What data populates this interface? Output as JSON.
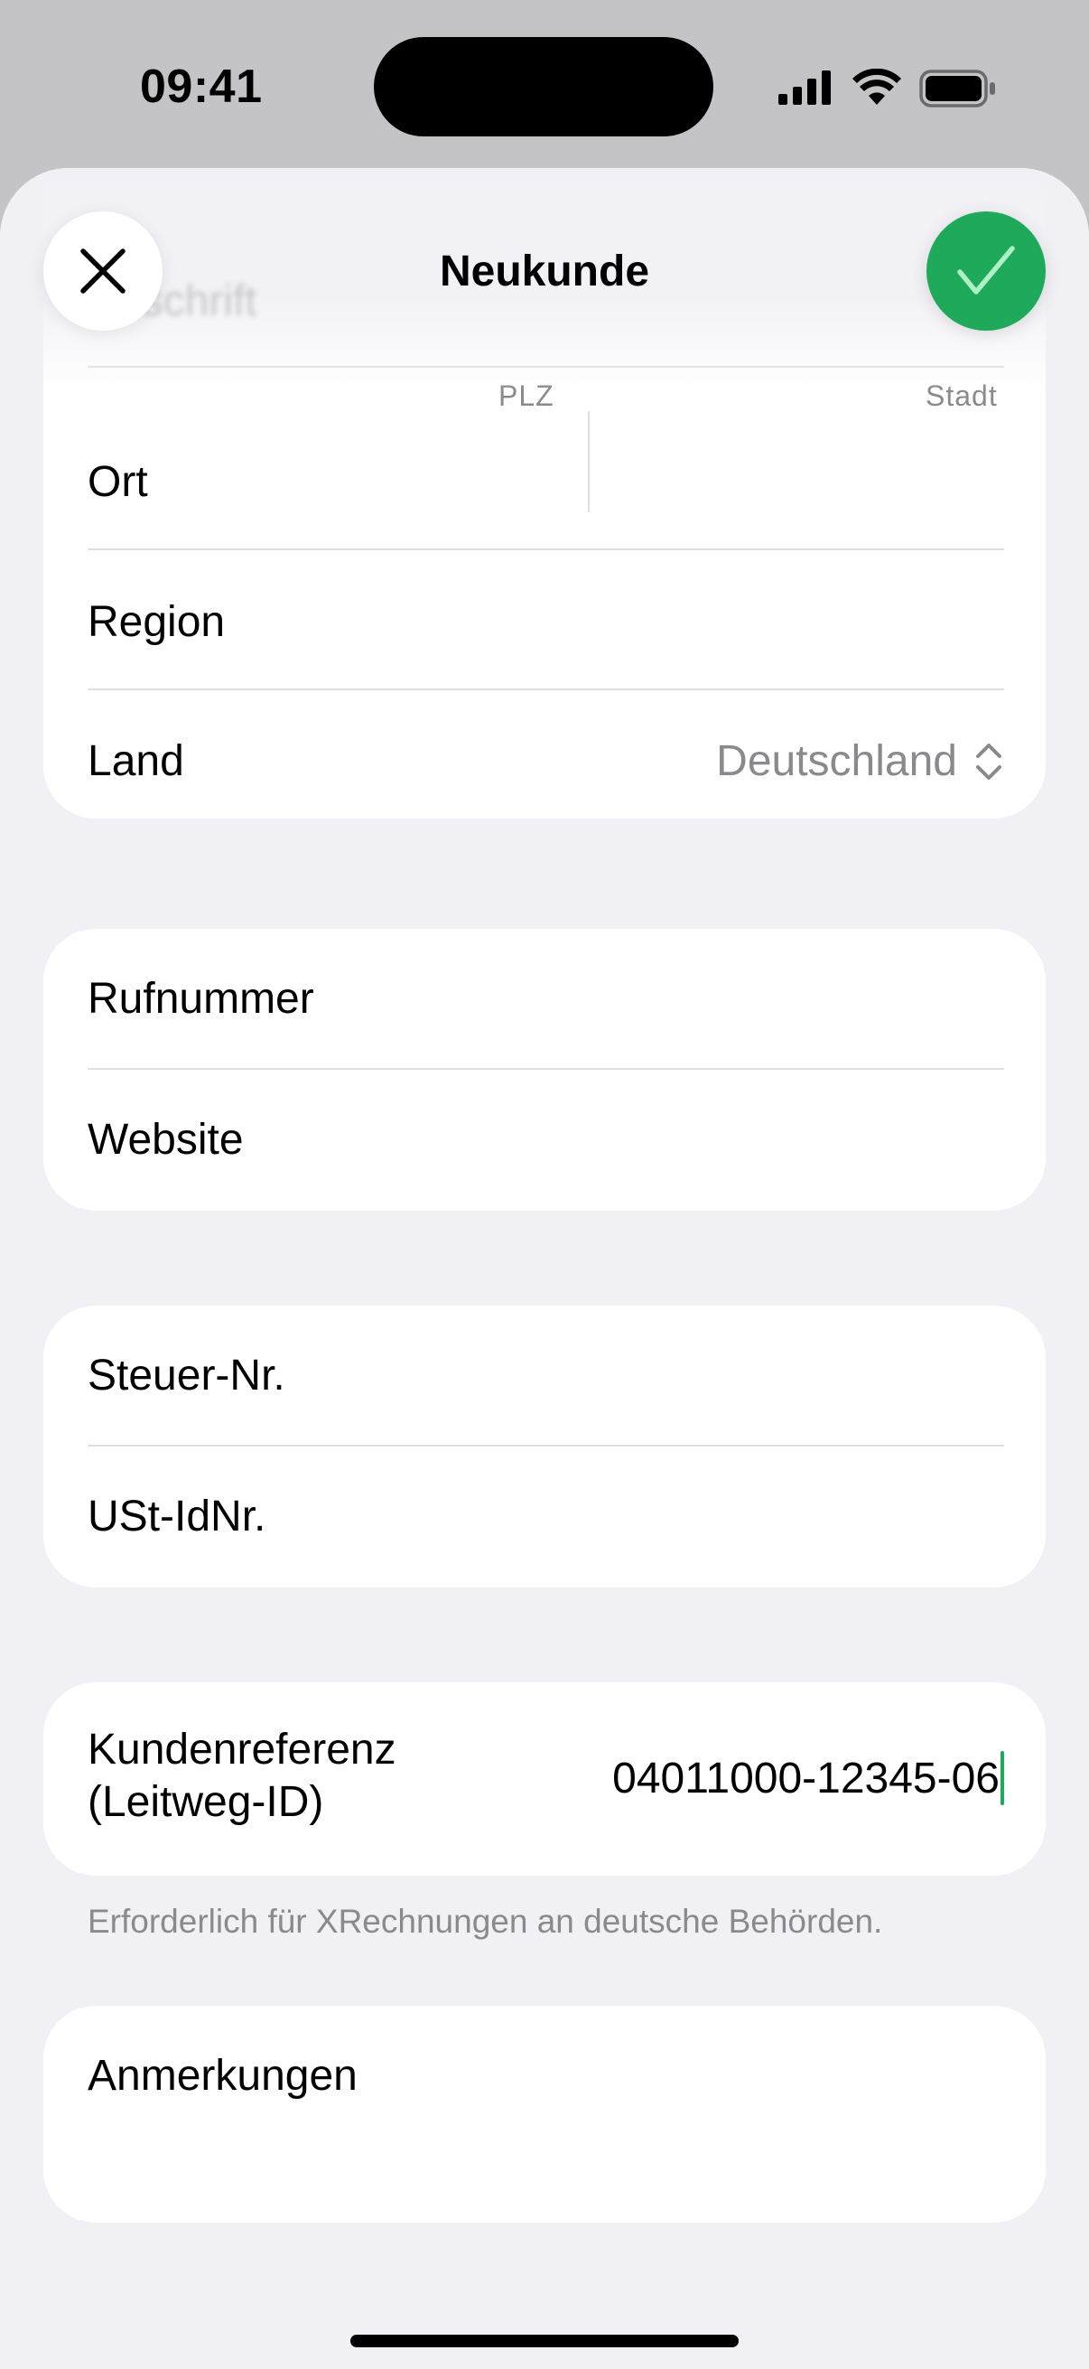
{
  "status": {
    "time": "09:41"
  },
  "header": {
    "title": "Neukunde",
    "ghost_text": "Anschrift"
  },
  "address": {
    "plz_label": "PLZ",
    "stadt_label": "Stadt",
    "ort_label": "Ort",
    "region_label": "Region",
    "land_label": "Land",
    "land_value": "Deutschland"
  },
  "contact": {
    "phone_label": "Rufnummer",
    "website_label": "Website"
  },
  "tax": {
    "steuer_label": "Steuer-Nr.",
    "ust_label": "USt-IdNr."
  },
  "reference": {
    "label_line1": "Kundenreferenz",
    "label_line2": "(Leitweg-ID)",
    "value": "04011000-12345-06",
    "footnote": "Erforderlich für XRechnungen an deutsche Behörden."
  },
  "notes": {
    "label": "Anmerkungen"
  },
  "colors": {
    "accent": "#1fa95a",
    "background": "#f0f0f5",
    "secondary_text": "#8a8a8e"
  },
  "icons": {
    "close": "close-icon",
    "confirm": "checkmark-icon",
    "updown": "chevron-up-down-icon",
    "signal": "cellular-signal-icon",
    "wifi": "wifi-icon",
    "battery": "battery-icon"
  }
}
